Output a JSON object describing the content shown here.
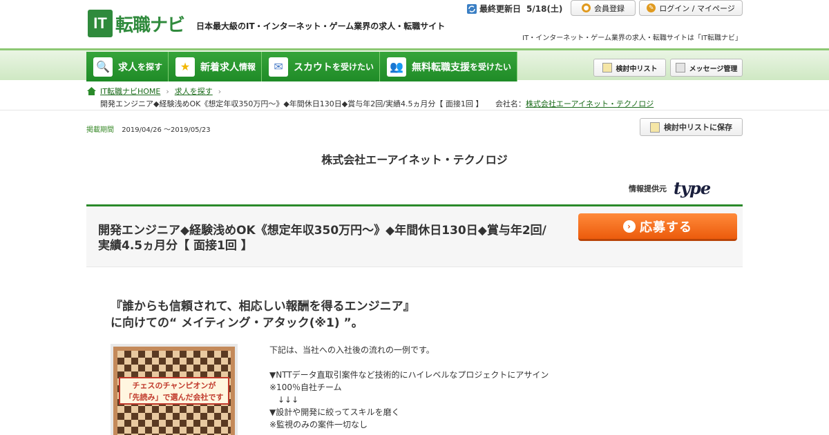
{
  "header": {
    "logo_it": "IT",
    "logo_text": "転職ナビ",
    "tagline": "日本最大級のIT・インターネット・ゲーム業界の求人・転職サイト",
    "updated_label": "最終更新日",
    "updated_date": "5/18(土)",
    "register_label": "会員登録",
    "login_label": "ログイン / マイページ",
    "tagline2": "IT・インターネット・ゲーム業界の求人・転職サイトは「IT転職ナビ」"
  },
  "nav": {
    "tabs": [
      {
        "main": "求人",
        "small": "を探す",
        "icon": "magnifier-icon"
      },
      {
        "main": "新着求人",
        "small": "情報",
        "icon": "star-icon"
      },
      {
        "main": "スカウト",
        "small": "を受けたい",
        "icon": "envelope-icon"
      },
      {
        "main": "無料転職支援",
        "small": "を受けたい",
        "icon": "people-icon"
      }
    ],
    "review_list_label": "検討中リスト",
    "message_label": "メッセージ管理"
  },
  "breadcrumb": {
    "home": "IT転職ナビHOME",
    "search": "求人を探す",
    "current": "開発エンジニア◆経験浅めOK《想定年収350万円～》◆年間休日130日◆賞与年2回/実績4.5ヵ月分【 面接1回 】",
    "company_label": "会社名：",
    "company_link": "株式会社エーアイネット・テクノロジ"
  },
  "posting": {
    "period_label": "掲載期間",
    "period_value": "2019/04/26 ～2019/05/23",
    "save_label": "検討中リストに保存",
    "company": "株式会社エーアイネット・テクノロジ",
    "provider_label": "情報提供元",
    "provider_logo": "type",
    "title": "開発エンジニア◆経験浅めOK《想定年収350万円～》◆年間休日130日◆賞与年2回/実績4.5ヵ月分【 面接1回 】",
    "apply_label": "応募する",
    "catch_line1": "『誰からも信頼されて、相応しい報酬を得るエンジニア』",
    "catch_line2": "に向けての“ メイティング・アタック(※1) ”。",
    "image_banner_line1": "チェスのチャンピオンが",
    "image_banner_line2": "「先読み」で選んだ会社です",
    "description": "下記は、当社への入社後の流れの一例です。\n\n▼NTTデータ直取引案件など技術的にハイレベルなプロジェクトにアサイン\n※100％自社チーム\n　↓↓↓\n▼設計や開発に絞ってスキルを磨く\n※監視のみの案件一切なし"
  },
  "colors": {
    "brand_green": "#2a8a2a",
    "apply_orange": "#ec5b0c"
  }
}
